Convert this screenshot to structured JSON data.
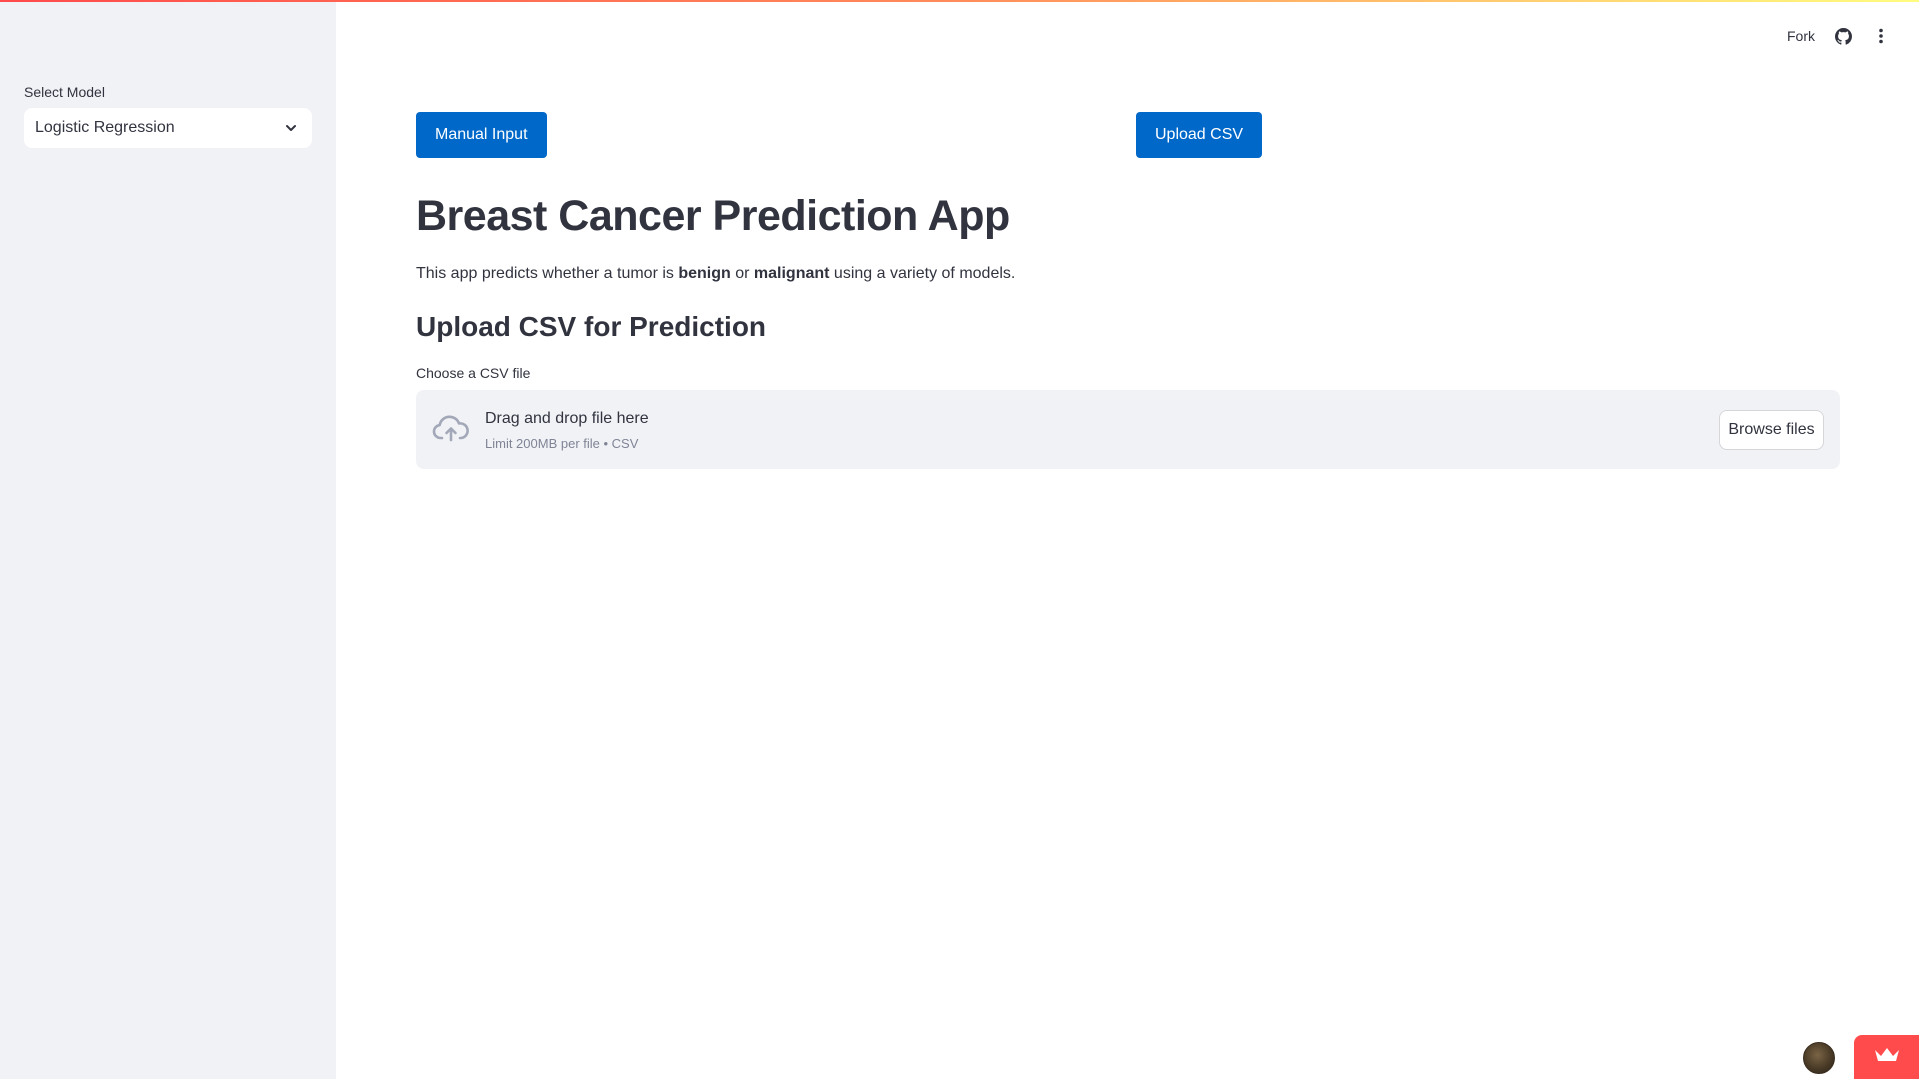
{
  "sidebar": {
    "select_label": "Select Model",
    "selected_model": "Logistic Regression"
  },
  "header": {
    "fork_label": "Fork"
  },
  "main": {
    "buttons": {
      "manual_input": "Manual Input",
      "upload_csv": "Upload CSV"
    },
    "title": "Breast Cancer Prediction App",
    "description": {
      "prefix": "This app predicts whether a tumor is ",
      "benign": "benign",
      "middle": " or ",
      "malignant": "malignant",
      "suffix": " using a variety of models."
    },
    "section_title": "Upload CSV for Prediction",
    "uploader": {
      "label": "Choose a CSV file",
      "drop_text": "Drag and drop file here",
      "limit_text": "Limit 200MB per file • CSV",
      "browse_label": "Browse files"
    }
  },
  "icons": {
    "github": "github-icon",
    "menu": "kebab-menu-icon",
    "cloud": "cloud-upload-icon",
    "chevron": "chevron-down-icon",
    "crown": "crown-icon"
  },
  "colors": {
    "primary": "#0068c9",
    "sidebar_bg": "#f0f2f6",
    "text": "#31333f",
    "badge": "#ff4b4b"
  }
}
